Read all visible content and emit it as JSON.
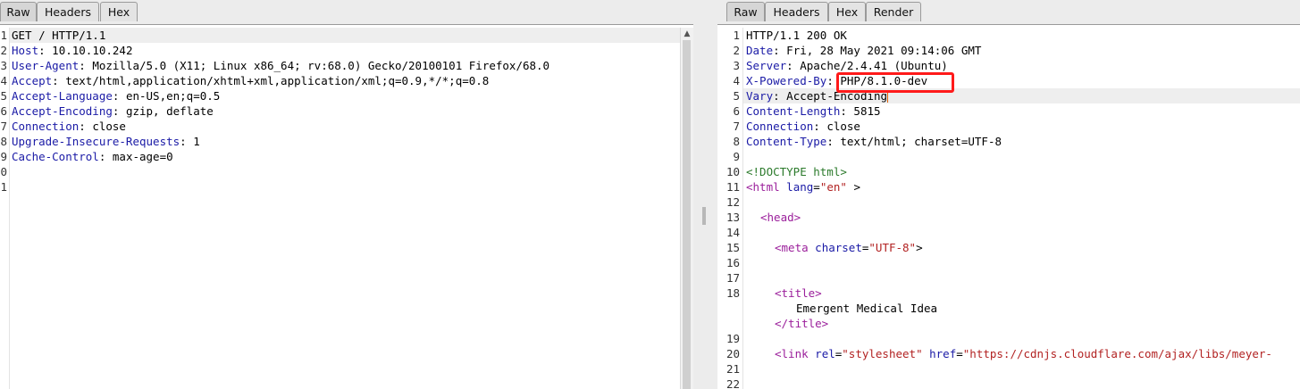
{
  "request": {
    "tabs": [
      "Raw",
      "Headers",
      "Hex"
    ],
    "line_numbers": [
      "1",
      "2",
      "3",
      "4",
      "5",
      "6",
      "7",
      "8",
      "9",
      "0",
      "1"
    ],
    "lines": [
      {
        "plain": "GET / HTTP/1.1"
      },
      {
        "key": "Host",
        "sep": ": ",
        "value": "10.10.10.242"
      },
      {
        "key": "User-Agent",
        "sep": ": ",
        "value": "Mozilla/5.0 (X11; Linux x86_64; rv:68.0) Gecko/20100101 Firefox/68.0"
      },
      {
        "key": "Accept",
        "sep": ": ",
        "value": "text/html,application/xhtml+xml,application/xml;q=0.9,*/*;q=0.8"
      },
      {
        "key": "Accept-Language",
        "sep": ": ",
        "value": "en-US,en;q=0.5"
      },
      {
        "key": "Accept-Encoding",
        "sep": ": ",
        "value": "gzip, deflate"
      },
      {
        "key": "Connection",
        "sep": ": ",
        "value": "close"
      },
      {
        "key": "Upgrade-Insecure-Requests",
        "sep": ": ",
        "value": "1"
      },
      {
        "key": "Cache-Control",
        "sep": ": ",
        "value": "max-age=0"
      }
    ]
  },
  "response": {
    "tabs": [
      "Raw",
      "Headers",
      "Hex",
      "Render"
    ],
    "status_line": "HTTP/1.1 200 OK",
    "headers": [
      {
        "key": "Date",
        "sep": ": ",
        "value": "Fri, 28 May 2021 09:14:06 GMT"
      },
      {
        "key": "Server",
        "sep": ": ",
        "value": "Apache/2.4.41 (Ubuntu)"
      },
      {
        "key": "X-Powered-By",
        "sep": ": ",
        "value": "PHP/8.1.0-dev"
      },
      {
        "key": "Vary",
        "sep": ": ",
        "value": "Accept-Encoding"
      },
      {
        "key": "Content-Length",
        "sep": ": ",
        "value": "5815"
      },
      {
        "key": "Connection",
        "sep": ": ",
        "value": "close"
      },
      {
        "key": "Content-Type",
        "sep": ": ",
        "value": "text/html; charset=UTF-8"
      }
    ],
    "body": {
      "doctype": "<!DOCTYPE html>",
      "html_open": "<html",
      "lang_attr": "lang",
      "lang_val": "\"en\"",
      "html_close": " >",
      "head_tag": "<head>",
      "meta_open": "<meta",
      "meta_attr": "charset",
      "meta_val": "\"UTF-8\"",
      "meta_close": ">",
      "title_open": "<title>",
      "title_text": "Emergent Medical Idea",
      "title_close": "</title>",
      "link_open": "<link",
      "link_rel_attr": "rel",
      "link_rel_val": "\"stylesheet\"",
      "link_href_attr": "href",
      "link_href_val": "\"https://cdnjs.cloudflare.com/ajax/libs/meyer-"
    },
    "line_numbers": [
      "1",
      "2",
      "3",
      "4",
      "5",
      "6",
      "7",
      "8",
      "9",
      "10",
      "11",
      "12",
      "13",
      "14",
      "15",
      "16",
      "17",
      "18",
      "19",
      "20",
      "21",
      "22"
    ]
  },
  "colors": {
    "highlight_box": "#ff1a1a"
  }
}
